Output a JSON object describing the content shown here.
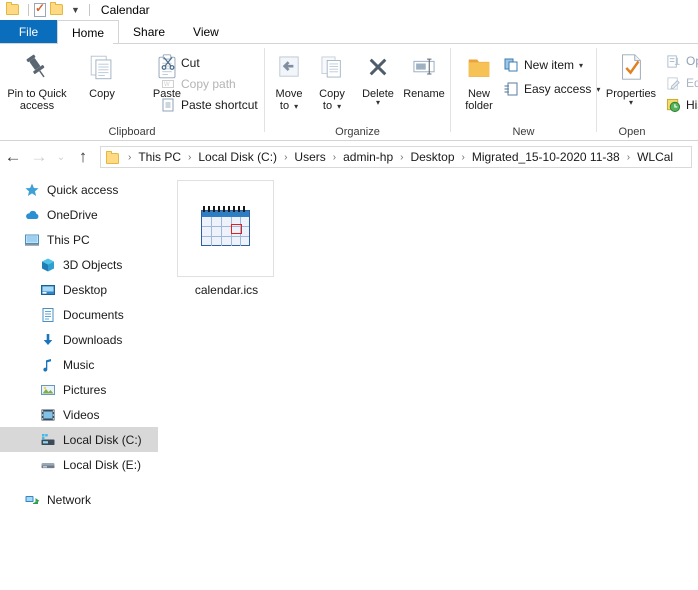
{
  "window": {
    "title": "Calendar",
    "titlebar_icons": [
      "folder-icon",
      "properties-check-icon",
      "folder-icon",
      "customize-quick-access-chevron-icon"
    ]
  },
  "tabs": [
    {
      "label": "File",
      "name": "tab-file",
      "active": false
    },
    {
      "label": "Home",
      "name": "tab-home",
      "active": true
    },
    {
      "label": "Share",
      "name": "tab-share",
      "active": false
    },
    {
      "label": "View",
      "name": "tab-view",
      "active": false
    }
  ],
  "ribbon": {
    "groups": [
      {
        "label": "Clipboard"
      },
      {
        "label": "Organize"
      },
      {
        "label": "New"
      },
      {
        "label": "Open"
      }
    ],
    "clipboard": {
      "pin_line1": "Pin to Quick",
      "pin_line2": "access",
      "copy": "Copy",
      "paste": "Paste",
      "cut": "Cut",
      "copy_path": "Copy path",
      "paste_shortcut": "Paste shortcut"
    },
    "organize": {
      "move_to_line1": "Move",
      "move_to_line2": "to",
      "copy_to_line1": "Copy",
      "copy_to_line2": "to",
      "delete": "Delete",
      "rename": "Rename"
    },
    "new": {
      "new_folder_line1": "New",
      "new_folder_line2": "folder",
      "new_item": "New item",
      "easy_access": "Easy access"
    },
    "open": {
      "properties": "Properties",
      "open": "Op",
      "edit": "Edi",
      "history": "His"
    }
  },
  "address": {
    "back": "←",
    "forward": "→",
    "recent": "⌄",
    "up": "↑",
    "crumbs": [
      "This PC",
      "Local Disk (C:)",
      "Users",
      "admin-hp",
      "Desktop",
      "Migrated_15-10-2020 11-38",
      "WLCal"
    ],
    "separator": "›"
  },
  "sidebar": {
    "items": [
      {
        "label": "Quick access",
        "icon": "star-icon",
        "indent": false,
        "selected": false
      },
      {
        "label": "OneDrive",
        "icon": "cloud-icon",
        "indent": false,
        "selected": false
      },
      {
        "label": "This PC",
        "icon": "monitor-icon",
        "indent": false,
        "selected": false
      },
      {
        "label": "3D Objects",
        "icon": "cube-icon",
        "indent": true,
        "selected": false
      },
      {
        "label": "Desktop",
        "icon": "desktop-icon",
        "indent": true,
        "selected": false
      },
      {
        "label": "Documents",
        "icon": "document-icon",
        "indent": true,
        "selected": false
      },
      {
        "label": "Downloads",
        "icon": "download-icon",
        "indent": true,
        "selected": false
      },
      {
        "label": "Music",
        "icon": "music-note-icon",
        "indent": true,
        "selected": false
      },
      {
        "label": "Pictures",
        "icon": "picture-icon",
        "indent": true,
        "selected": false
      },
      {
        "label": "Videos",
        "icon": "film-icon",
        "indent": true,
        "selected": false
      },
      {
        "label": "Local Disk (C:)",
        "icon": "hard-drive-icon",
        "indent": true,
        "selected": true
      },
      {
        "label": "Local Disk (E:)",
        "icon": "disk-drive-icon",
        "indent": true,
        "selected": false
      },
      {
        "label": "Network",
        "icon": "network-icon",
        "indent": false,
        "selected": false
      }
    ]
  },
  "content": {
    "files": [
      {
        "name": "calendar.ics",
        "icon": "calendar-file-icon"
      }
    ]
  },
  "colors": {
    "file_tab": "#0b6ebd",
    "selection": "#d8d8d8",
    "folder": "#ffd983",
    "calendar_header": "#2f7ec4",
    "calendar_highlight": "#e02020"
  }
}
